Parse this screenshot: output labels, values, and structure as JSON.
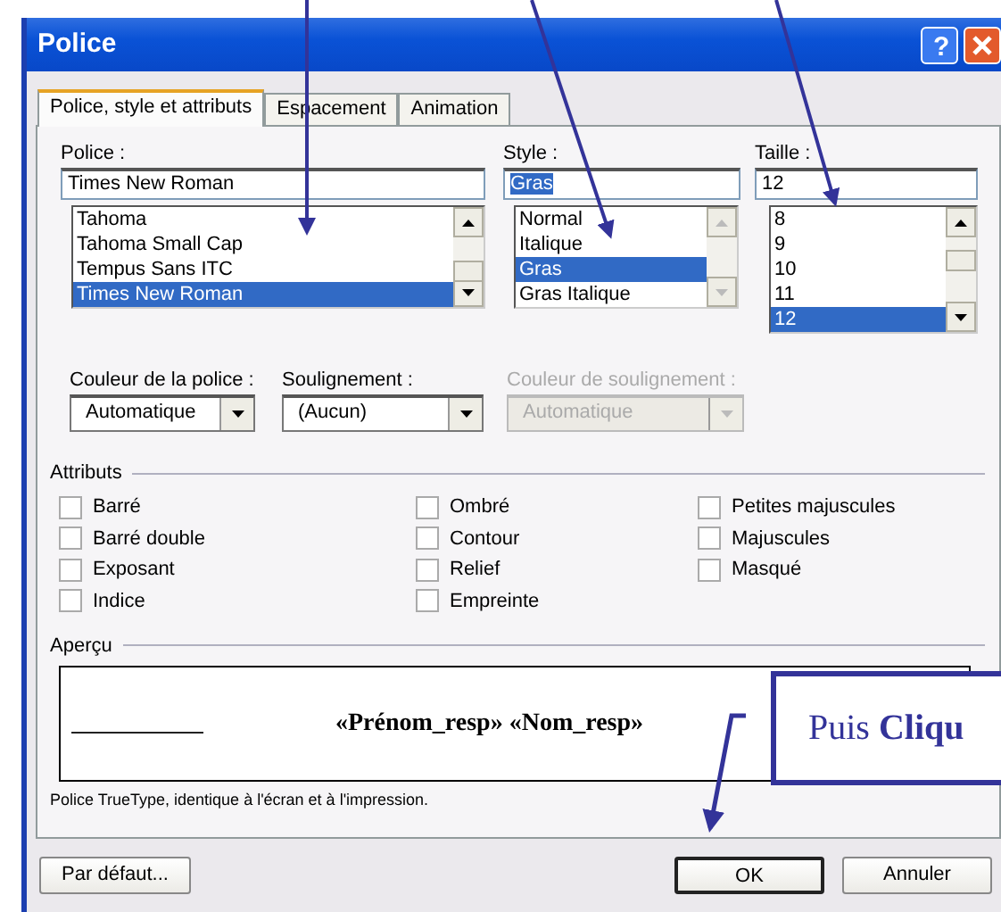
{
  "window": {
    "title": "Police",
    "title_buttons": [
      {
        "kind": "help",
        "label": "?"
      },
      {
        "kind": "close"
      }
    ]
  },
  "tabs": [
    {
      "label": "Police, style et attributs",
      "selected": true
    },
    {
      "label": "Espacement",
      "selected": false
    },
    {
      "label": "Animation",
      "selected": false
    }
  ],
  "pickers": [
    {
      "label": "Police :",
      "value": "Times New Roman",
      "value_selected": false,
      "scrollbar_disabled": false,
      "items": [
        {
          "label": "Tahoma",
          "selected": false
        },
        {
          "label": "Tahoma Small Cap",
          "selected": false
        },
        {
          "label": "Tempus Sans ITC",
          "selected": false
        },
        {
          "label": "Times New Roman",
          "selected": true
        }
      ]
    },
    {
      "label": "Style :",
      "value": "Gras",
      "value_selected": true,
      "scrollbar_disabled": true,
      "items": [
        {
          "label": "Normal",
          "selected": false
        },
        {
          "label": "Italique",
          "selected": false
        },
        {
          "label": "Gras",
          "selected": true
        },
        {
          "label": "Gras Italique",
          "selected": false
        }
      ]
    },
    {
      "label": "Taille :",
      "value": "12",
      "value_selected": false,
      "scrollbar_disabled": false,
      "items": [
        {
          "label": "8",
          "selected": false
        },
        {
          "label": "9",
          "selected": false
        },
        {
          "label": "10",
          "selected": false
        },
        {
          "label": "11",
          "selected": false
        },
        {
          "label": "12",
          "selected": true
        }
      ]
    }
  ],
  "dropdowns": [
    {
      "label": "Couleur de la police :",
      "value": "Automatique",
      "disabled": false
    },
    {
      "label": "Soulignement :",
      "value": "(Aucun)",
      "disabled": false
    },
    {
      "label": "Couleur de soulignement :",
      "value": "Automatique",
      "disabled": true
    }
  ],
  "attributes": {
    "title": "Attributs",
    "columns": [
      [
        {
          "label": "Barré",
          "checked": false
        },
        {
          "label": "Barré double",
          "checked": false
        },
        {
          "label": "Exposant",
          "checked": false
        },
        {
          "label": "Indice",
          "checked": false
        }
      ],
      [
        {
          "label": "Ombré",
          "checked": false
        },
        {
          "label": "Contour",
          "checked": false
        },
        {
          "label": "Relief",
          "checked": false
        },
        {
          "label": "Empreinte",
          "checked": false
        }
      ],
      [
        {
          "label": "Petites majuscules",
          "checked": false
        },
        {
          "label": "Majuscules",
          "checked": false
        },
        {
          "label": "Masqué",
          "checked": false
        }
      ]
    ]
  },
  "preview": {
    "title": "Aperçu",
    "text": "«Prénom_resp» «Nom_resp»",
    "note": "Police TrueType, identique à l'écran et à l'impression."
  },
  "buttons": [
    {
      "label": "Par défaut...",
      "default": false
    },
    {
      "label": "OK",
      "default": true
    },
    {
      "label": "Annuler",
      "default": false
    }
  ],
  "callout": {
    "text": "Puis **Cliqu**"
  }
}
